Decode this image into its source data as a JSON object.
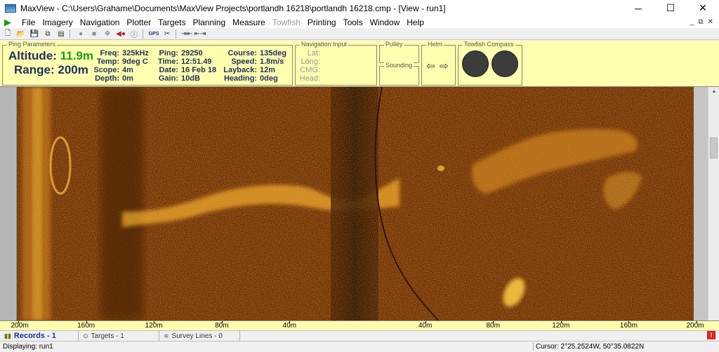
{
  "window": {
    "title": "MaxView - C:\\Users\\Grahame\\Documents\\MaxView Projects\\portlandh 16218\\portlandh 16218.cmp - [View - run1]",
    "minimize": "─",
    "maximize": "☐",
    "close": "✕"
  },
  "menu": {
    "items": [
      "File",
      "Imagery",
      "Navigation",
      "Plotter",
      "Targets",
      "Planning",
      "Measure",
      "Towfish",
      "Printing",
      "Tools",
      "Window",
      "Help"
    ],
    "mdi_minimize": "_",
    "mdi_restore": "⧉",
    "mdi_close": "✕"
  },
  "toolbar": {
    "icons": [
      "new-icon",
      "open-icon",
      "save-icon",
      "copy-icon",
      "paste-icon",
      "record-icon",
      "stop-icon",
      "layers-icon",
      "fish-icon",
      "info-icon",
      "gps-icon",
      "scissors-icon",
      "shrink-icon",
      "expand-icon"
    ],
    "gps_label": "GPS"
  },
  "ping_parameters": {
    "group_label": "Ping Parameters",
    "altitude_label": "Altitude:",
    "altitude_value": "11.9m",
    "range_label": "Range:",
    "range_value": "200m",
    "freq_label": "Freq:",
    "freq_value": "325kHz",
    "temp_label": "Temp:",
    "temp_value": "9deg C",
    "scope_label": "Scope:",
    "scope_value": "4m",
    "depth_label": "Depth:",
    "depth_value": "0m",
    "ping_label": "Ping:",
    "ping_value": "29250",
    "time_label": "Time:",
    "time_value": "12:51.49",
    "date_label": "Date:",
    "date_value": "16 Feb 18",
    "gain_label": "Gain:",
    "gain_value": "10dB",
    "course_label": "Course:",
    "course_value": "135deg",
    "speed_label": "Speed:",
    "speed_value": "1.8m/s",
    "layback_label": "Layback:",
    "layback_value": "12m",
    "heading_label": "Heading:",
    "heading_value": "0deg"
  },
  "navigation_input": {
    "group_label": "Navigation Input",
    "lat_label": "Lat:",
    "long_label": "Long:",
    "cmg_label": "CMG:",
    "head_label": "Head:"
  },
  "pulley": {
    "group_label": "Pulley"
  },
  "sounding": {
    "group_label": "Sounding"
  },
  "helm": {
    "group_label": "Helm",
    "left": "⇦",
    "right": "⇨"
  },
  "towfish_compass": {
    "group_label": "Towfish Compass"
  },
  "range_ruler": {
    "ticks": [
      {
        "label": "200m",
        "pos": 0
      },
      {
        "label": "160m",
        "pos": 0.1
      },
      {
        "label": "120m",
        "pos": 0.2
      },
      {
        "label": "80m",
        "pos": 0.3
      },
      {
        "label": "40m",
        "pos": 0.4
      },
      {
        "label": "40m",
        "pos": 0.6
      },
      {
        "label": "80m",
        "pos": 0.7
      },
      {
        "label": "120m",
        "pos": 0.8
      },
      {
        "label": "160m",
        "pos": 0.9
      },
      {
        "label": "200m",
        "pos": 1
      }
    ]
  },
  "tabs": {
    "records": "Records - 1",
    "targets": "Targets - 1",
    "survey_lines": "Survey Lines - 0",
    "alert": "!"
  },
  "status": {
    "displaying": "Displaying: run1",
    "cursor": "Cursor: 2°25.2524W,  50°35.0822N"
  },
  "colors": {
    "panel": "#ffffb0",
    "label": "#1f2e5f",
    "altitude": "#15a015",
    "sonar_dark": "#7a3605",
    "sonar_bright": "#ffcc33"
  }
}
